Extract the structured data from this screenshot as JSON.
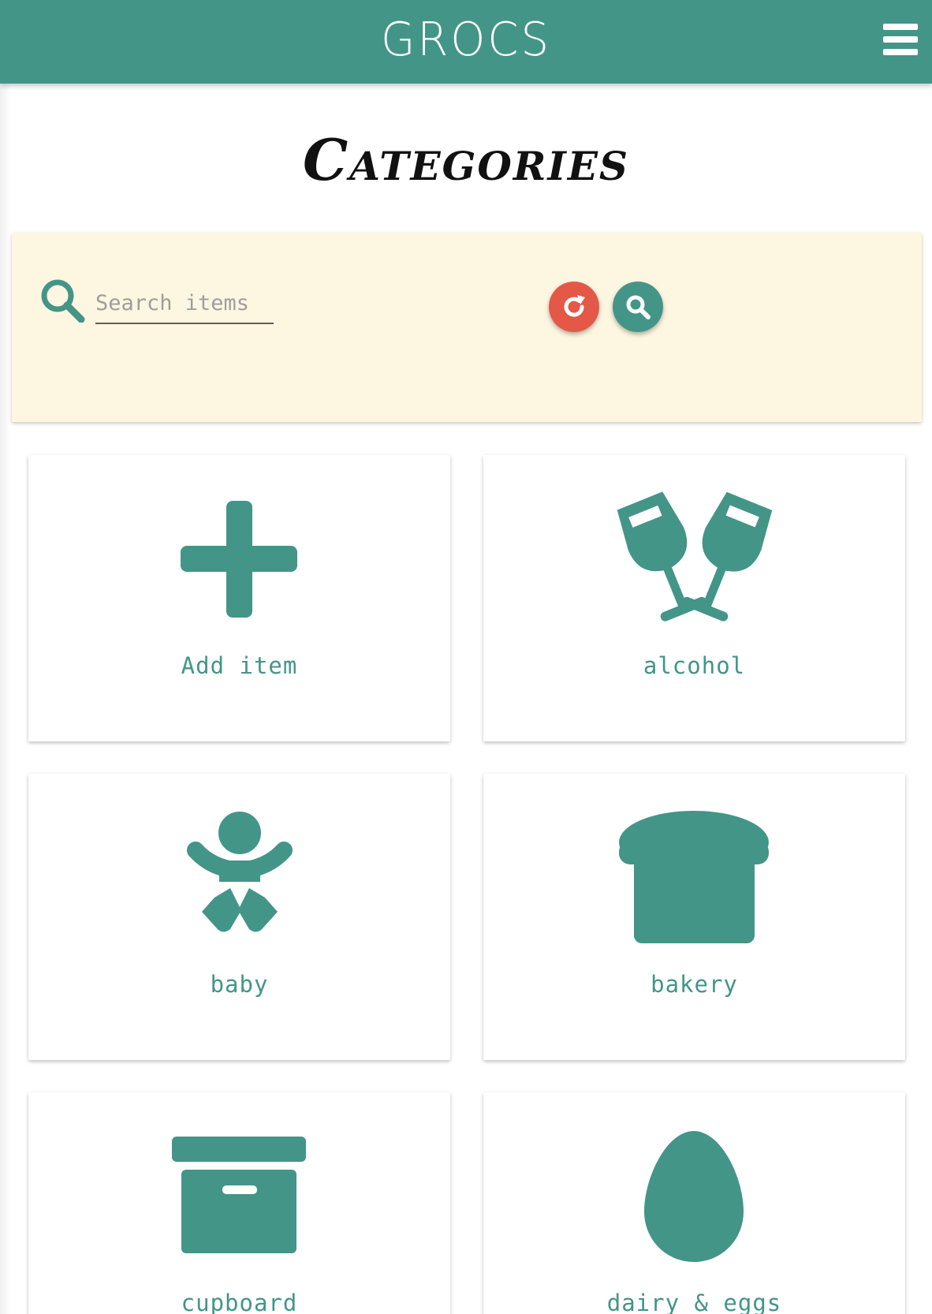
{
  "header": {
    "app_title": "GROCS",
    "menu_icon": "hamburger-menu-icon"
  },
  "page": {
    "heading": "Categories"
  },
  "search": {
    "placeholder": "Search items",
    "value": "",
    "search_icon": "search-icon",
    "reset_icon": "refresh-icon",
    "submit_icon": "search-icon"
  },
  "colors": {
    "primary": "#439587",
    "panel": "#fdf6e1",
    "reset": "#e45847"
  },
  "categories": [
    {
      "label": "Add item",
      "icon": "plus-icon"
    },
    {
      "label": "alcohol",
      "icon": "wine-glasses-icon"
    },
    {
      "label": "baby",
      "icon": "baby-icon"
    },
    {
      "label": "bakery",
      "icon": "bread-icon"
    },
    {
      "label": "cupboard",
      "icon": "archive-box-icon"
    },
    {
      "label": "dairy & eggs",
      "icon": "egg-icon"
    }
  ]
}
